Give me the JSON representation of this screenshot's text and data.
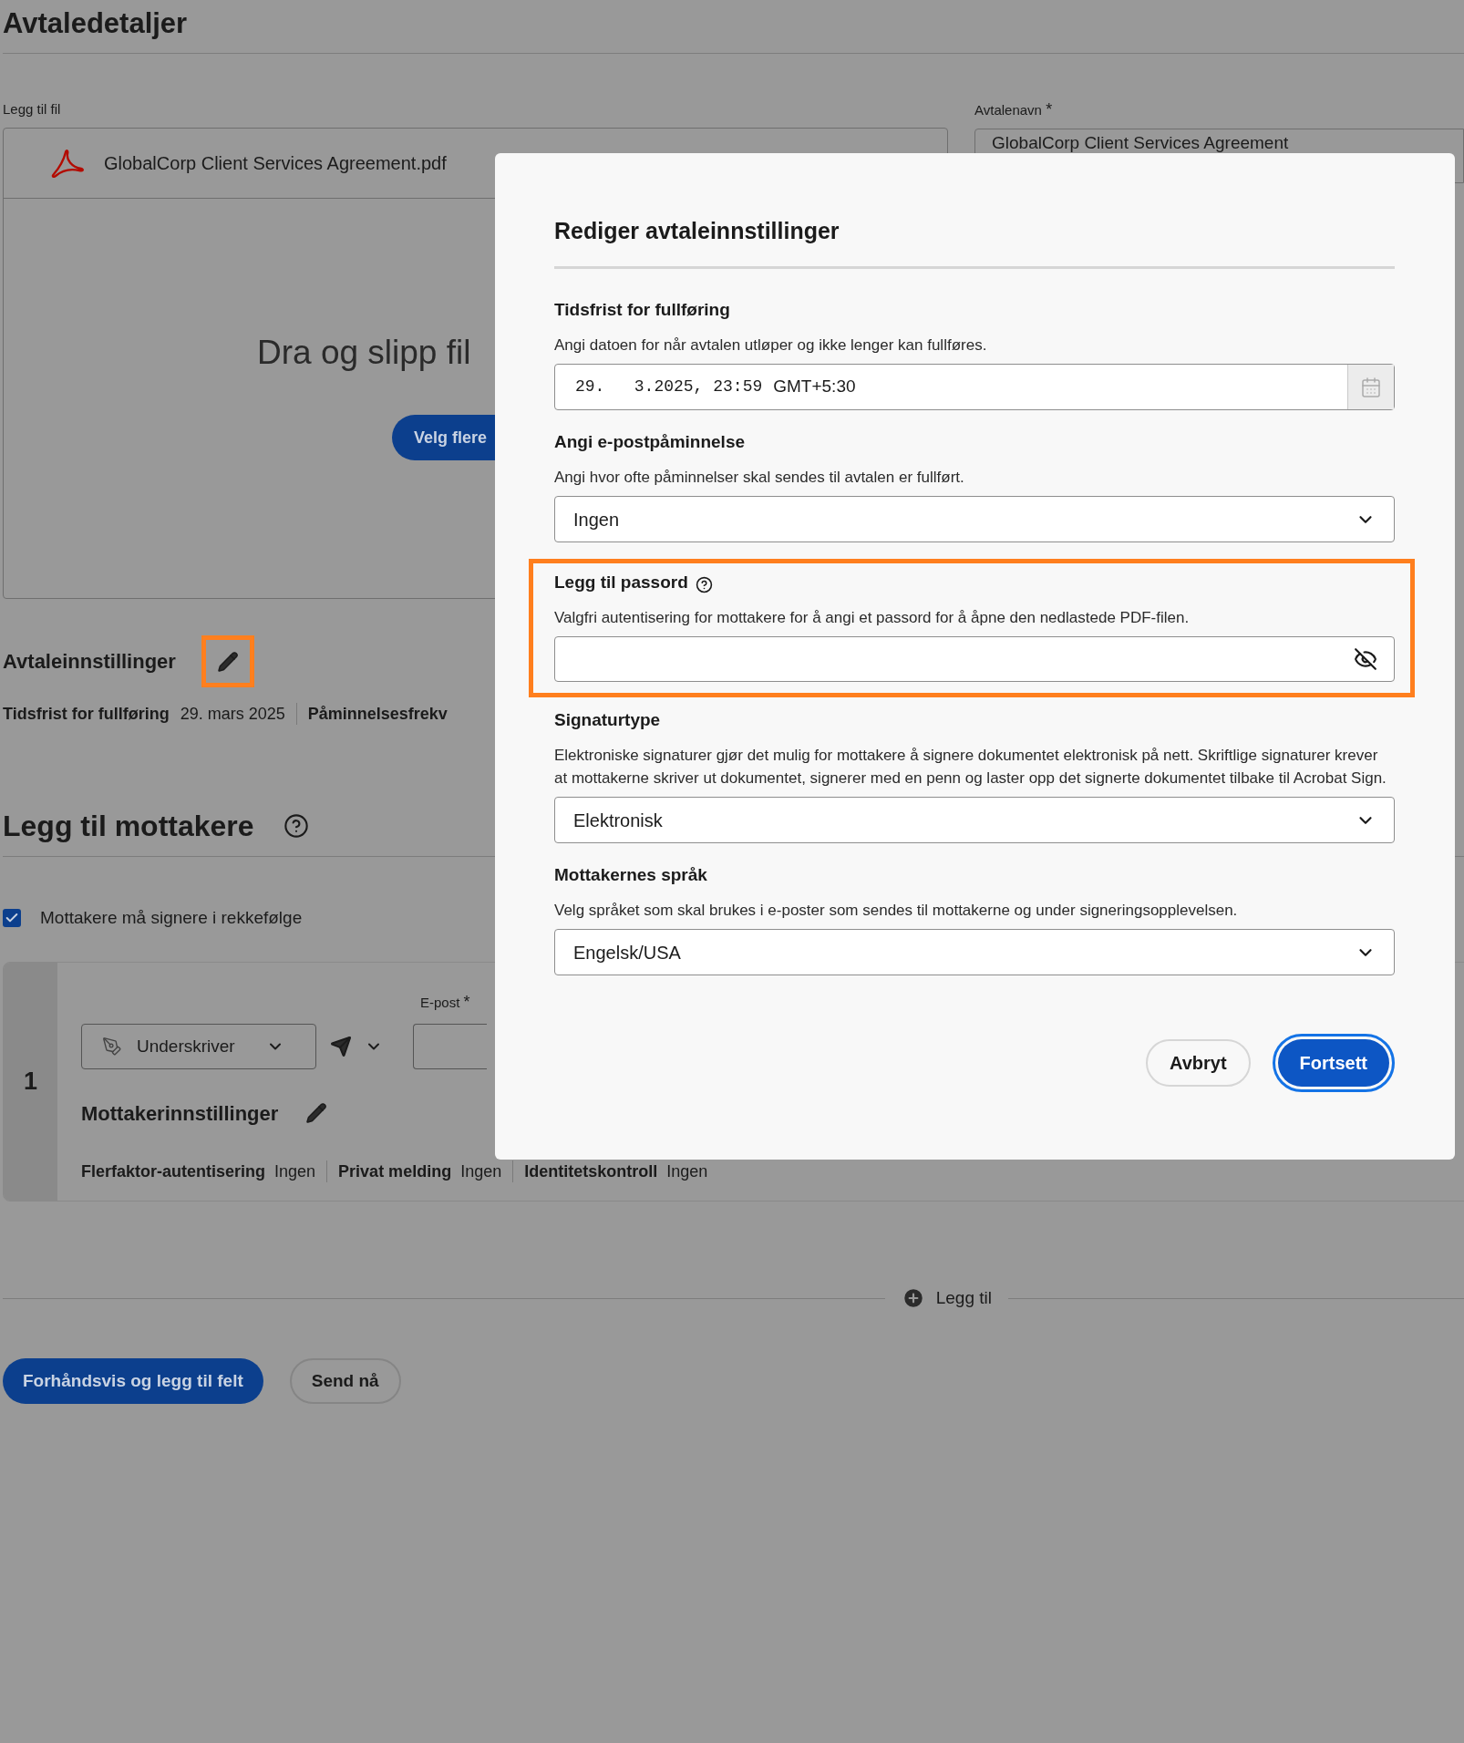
{
  "page": {
    "title": "Avtaledetaljer",
    "file_section": {
      "label": "Legg til fil",
      "file_name": "GlobalCorp Client Services Agreement.pdf",
      "drop_text": "Dra og slipp fil",
      "browse_button": "Velg flere"
    },
    "agreement_name": {
      "label": "Avtalenavn",
      "required_mark": "*",
      "value": "GlobalCorp Client Services Agreement"
    },
    "settings": {
      "title": "Avtaleinnstillinger",
      "edit_highlighted": true,
      "items": [
        {
          "label": "Tidsfrist for fullføring",
          "value": "29. mars 2025"
        },
        {
          "label": "Påminnelsesfrekv"
        }
      ]
    }
  },
  "recipients": {
    "title": "Legg til mottakere",
    "sign_in_order": {
      "label": "Mottakere må signere i rekkefølge",
      "checked": true
    },
    "list": [
      {
        "number": "1",
        "role": "Underskriver",
        "email_label": "E-post",
        "required_mark": "*",
        "settings_title": "Mottakerinnstillinger",
        "settings": [
          {
            "label": "Flerfaktor-autentisering",
            "value": "Ingen"
          },
          {
            "label": "Privat melding",
            "value": "Ingen"
          },
          {
            "label": "Identitetskontroll",
            "value": "Ingen"
          }
        ]
      }
    ],
    "add_button": "Legg til"
  },
  "actions": [
    {
      "label": "Forhåndsvis og legg til felt",
      "primary": true
    },
    {
      "label": "Send nå",
      "primary": false
    }
  ],
  "dialog": {
    "title": "Rediger avtaleinnstillinger",
    "sections": [
      {
        "kind": "date",
        "label": "Tidsfrist for fullføring",
        "help": "Angi datoen for når avtalen utløper og ikke lenger kan fullføres.",
        "value": "29.   3.2025, 23:59",
        "timezone": "GMT+5:30",
        "highlighted": false
      },
      {
        "kind": "select",
        "label": "Angi e-postpåminnelse",
        "help": "Angi hvor ofte påminnelser skal sendes til avtalen er fullført.",
        "value": "Ingen",
        "highlighted": false
      },
      {
        "kind": "password",
        "label": "Legg til passord",
        "help": "Valgfri autentisering for mottakere for å angi et passord for å åpne den nedlastede PDF-filen.",
        "highlighted": true
      },
      {
        "kind": "select",
        "label": "Signaturtype",
        "help": "Elektroniske signaturer gjør det mulig for mottakere å signere dokumentet elektronisk på nett. Skriftlige signaturer krever at mottakerne skriver ut dokumentet, signerer med en penn og laster opp det signerte dokumentet tilbake til Acrobat Sign.",
        "value": "Elektronisk",
        "highlighted": false
      },
      {
        "kind": "select",
        "label": "Mottakernes språk",
        "help": "Velg språket som skal brukes i e-poster som sendes til mottakerne og under signeringsopplevelsen.",
        "value": "Engelsk/USA",
        "highlighted": false
      }
    ],
    "buttons": [
      {
        "label": "Avbryt",
        "primary": false,
        "focused": false
      },
      {
        "label": "Fortsett",
        "primary": true,
        "focused": true
      }
    ]
  }
}
